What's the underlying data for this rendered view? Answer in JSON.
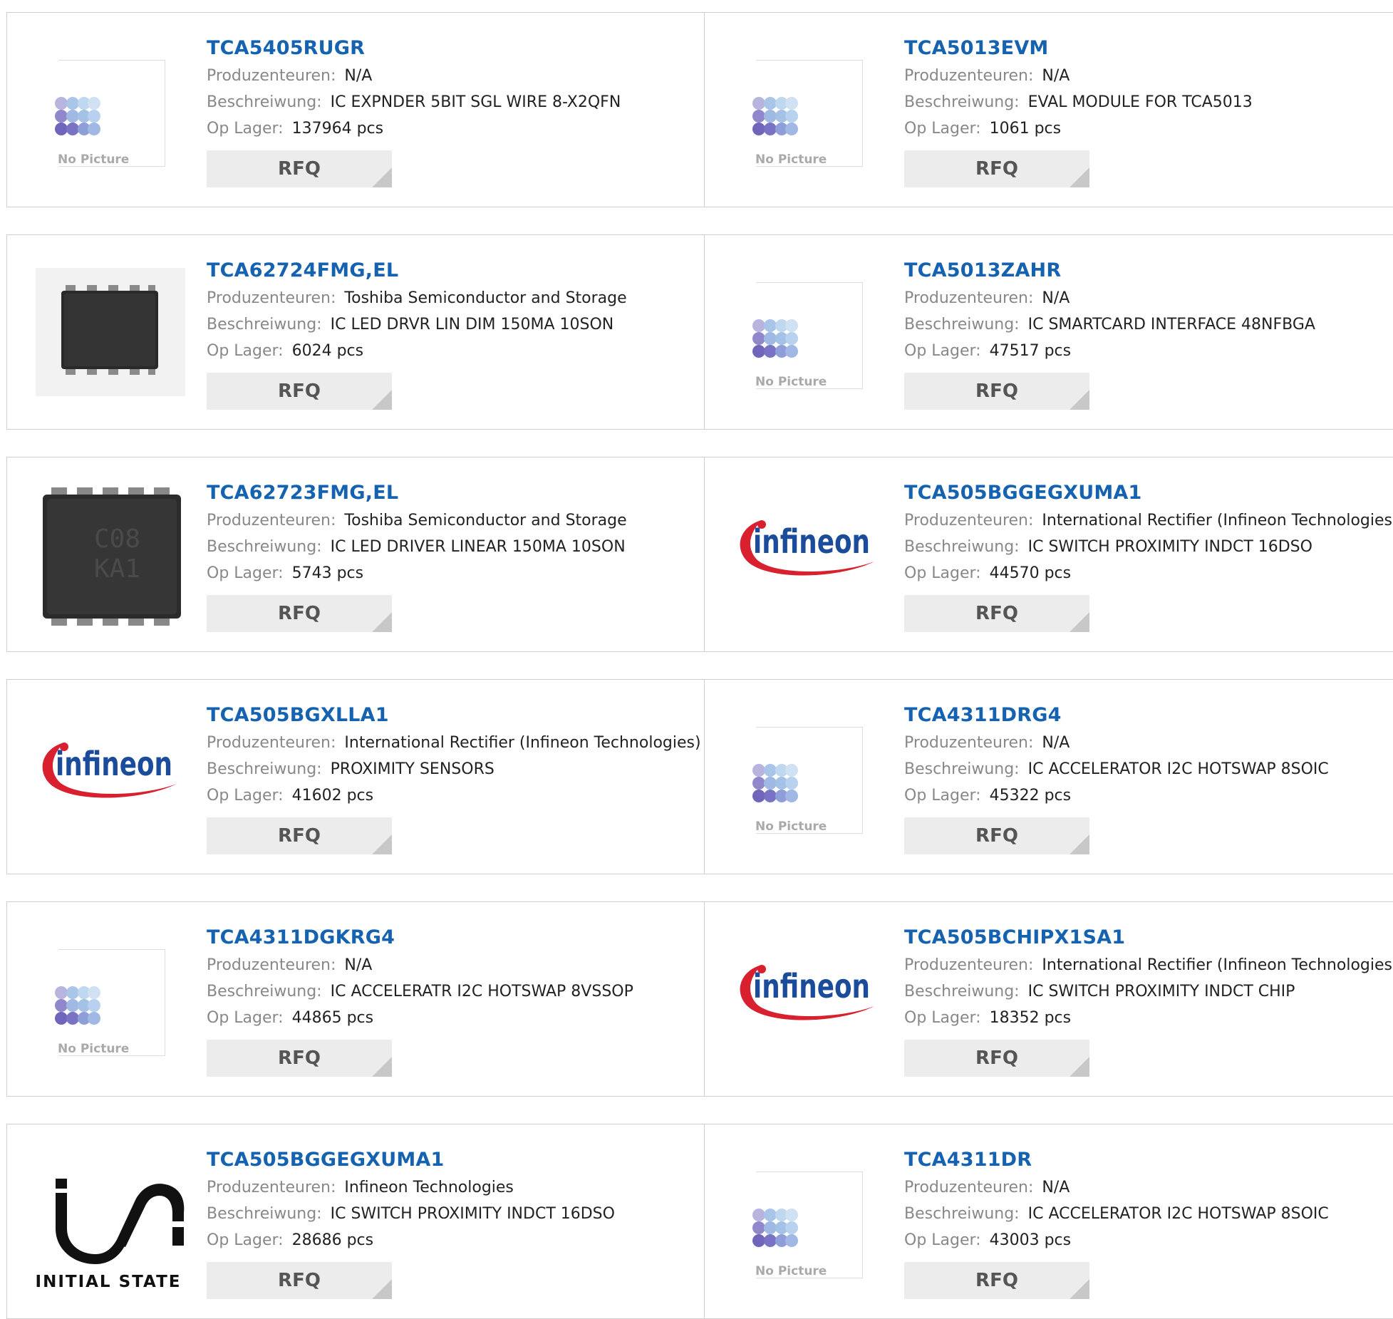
{
  "labels": {
    "manufacturer": "Produzenteuren:",
    "description": "Beschreiwung:",
    "stock": "Op Lager:",
    "rfq": "RFQ",
    "no_picture": "No Picture"
  },
  "products": [
    {
      "part": "TCA5405RUGR",
      "manufacturer": "N/A",
      "description": "IC EXPNDER 5BIT SGL WIRE 8-X2QFN",
      "stock": "137964 pcs",
      "image": "no-picture"
    },
    {
      "part": "TCA5013EVM",
      "manufacturer": "N/A",
      "description": "EVAL MODULE FOR TCA5013",
      "stock": "1061 pcs",
      "image": "no-picture"
    },
    {
      "part": "TCA62724FMG,EL",
      "manufacturer": "Toshiba Semiconductor and Storage",
      "description": "IC LED DRVR LIN DIM 150MA 10SON",
      "stock": "6024 pcs",
      "image": "chip-small"
    },
    {
      "part": "TCA5013ZAHR",
      "manufacturer": "N/A",
      "description": "IC SMARTCARD INTERFACE 48NFBGA",
      "stock": "47517 pcs",
      "image": "no-picture"
    },
    {
      "part": "TCA62723FMG,EL",
      "manufacturer": "Toshiba Semiconductor and Storage",
      "description": "IC LED DRIVER LINEAR 150MA 10SON",
      "stock": "5743 pcs",
      "image": "chip-large"
    },
    {
      "part": "TCA505BGGEGXUMA1",
      "manufacturer": "International Rectifier (Infineon Technologies)",
      "description": "IC SWITCH PROXIMITY INDCT 16DSO",
      "stock": "44570 pcs",
      "image": "infineon-logo"
    },
    {
      "part": "TCA505BGXLLA1",
      "manufacturer": "International Rectifier (Infineon Technologies)",
      "description": "PROXIMITY SENSORS",
      "stock": "41602 pcs",
      "image": "infineon-logo"
    },
    {
      "part": "TCA4311DRG4",
      "manufacturer": "N/A",
      "description": "IC ACCELERATOR I2C HOTSWAP 8SOIC",
      "stock": "45322 pcs",
      "image": "no-picture"
    },
    {
      "part": "TCA4311DGKRG4",
      "manufacturer": "N/A",
      "description": "IC ACCELERATR I2C HOTSWAP 8VSSOP",
      "stock": "44865 pcs",
      "image": "no-picture"
    },
    {
      "part": "TCA505BCHIPX1SA1",
      "manufacturer": "International Rectifier (Infineon Technologies)",
      "description": "IC SWITCH PROXIMITY INDCT CHIP",
      "stock": "18352 pcs",
      "image": "infineon-logo"
    },
    {
      "part": "TCA505BGGEGXUMA1",
      "manufacturer": "Infineon Technologies",
      "description": "IC SWITCH PROXIMITY INDCT 16DSO",
      "stock": "28686 pcs",
      "image": "initial-state-logo"
    },
    {
      "part": "TCA4311DR",
      "manufacturer": "N/A",
      "description": "IC ACCELERATOR I2C HOTSWAP 8SOIC",
      "stock": "43003 pcs",
      "image": "no-picture"
    }
  ],
  "logos": {
    "infineon": "infineon",
    "initial_state": "INITIAL STATE"
  },
  "colors": {
    "part_link": "#1562b0",
    "label": "#888888",
    "rfq_bg": "#ececec",
    "infineon_red": "#d8202f",
    "infineon_blue": "#1b4c9b"
  }
}
